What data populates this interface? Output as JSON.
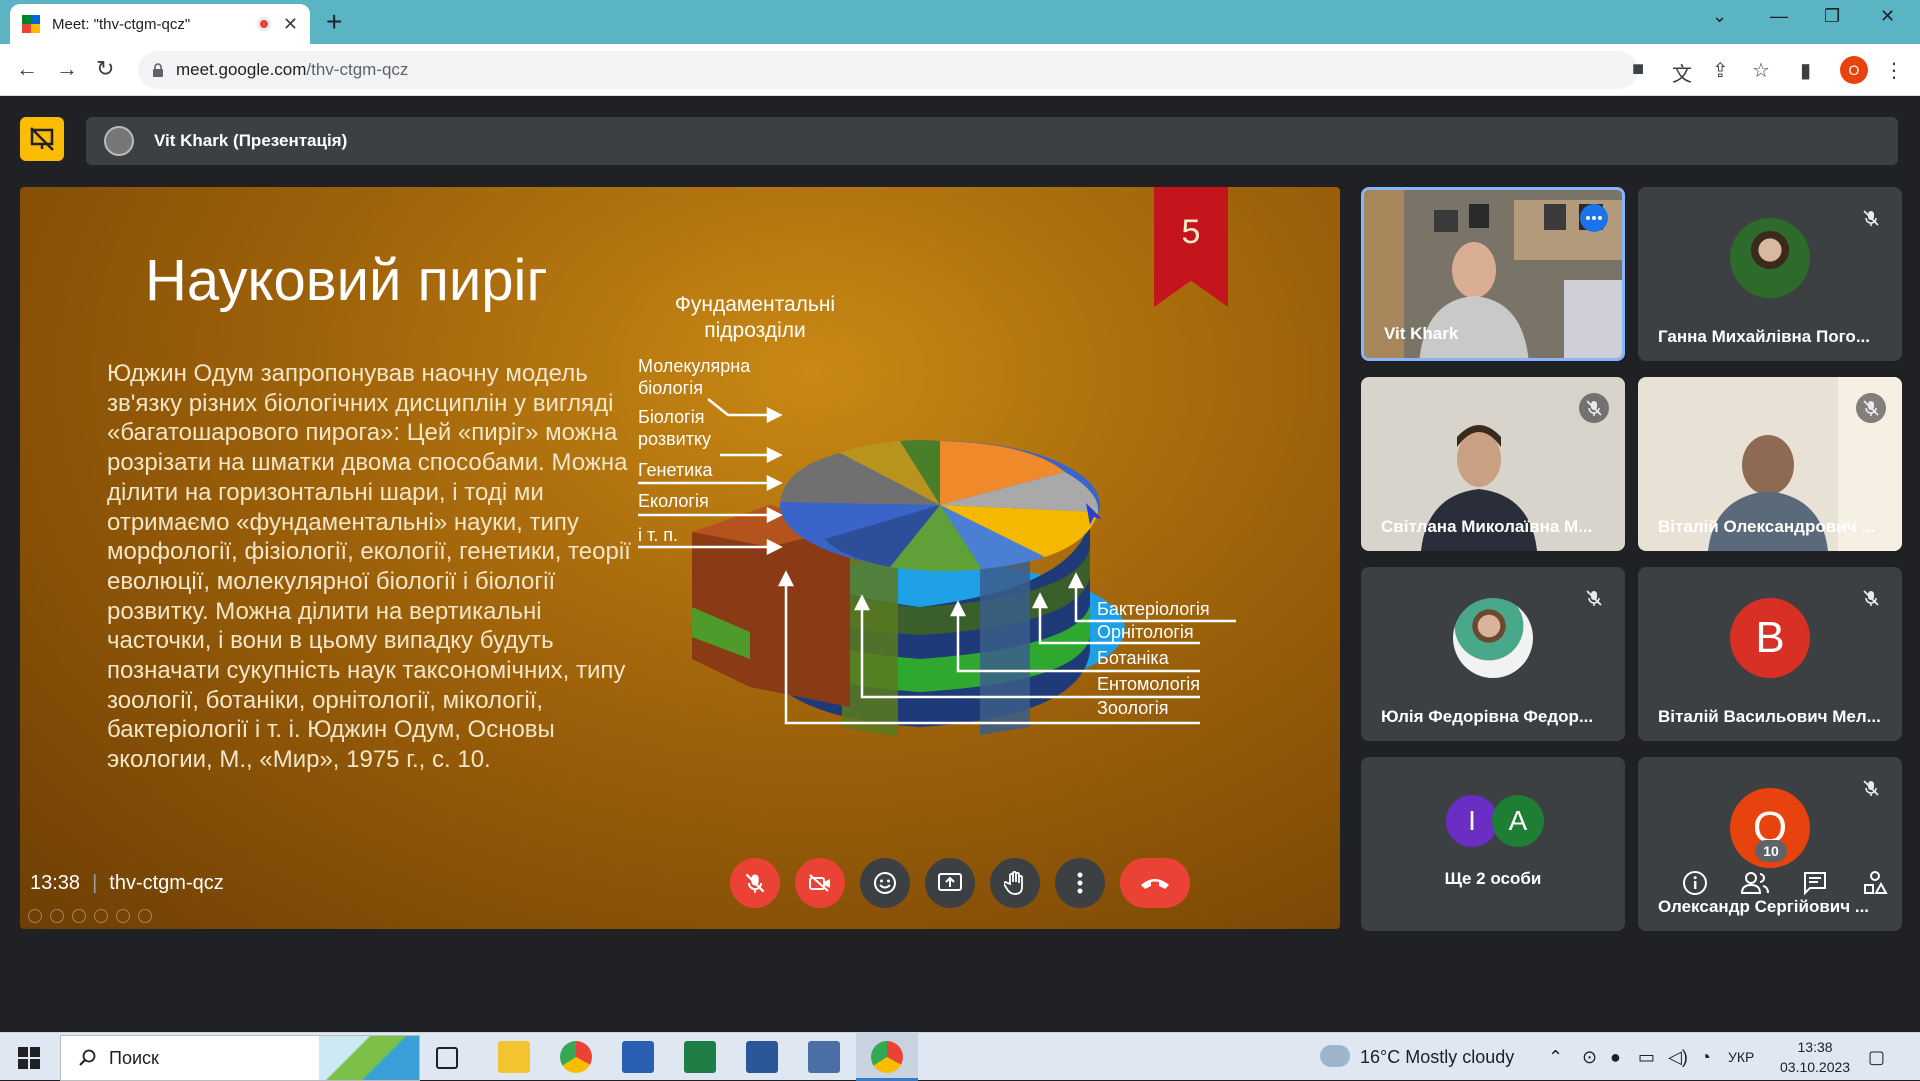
{
  "browser": {
    "tab_title": "Meet: \"thv-ctgm-qcz\"",
    "url_host": "meet.google.com",
    "url_path": "/thv-ctgm-qcz",
    "profile_letter": "O"
  },
  "meet": {
    "presenter_label": "Vit Khark (Презентація)",
    "time": "13:38",
    "meeting_code": "thv-ctgm-qcz",
    "people_count": "10"
  },
  "slide": {
    "title": "Науковий пиріг",
    "ribbon_number": "5",
    "body": "Юджин Одум запропонував наочну модель зв'язку різних біологічних дисциплін у вигляді «багатошарового пирога»: Цей «пиріг» можна розрізати на шматки двома способами. Можна ділити на горизонтальні шари, і тоді ми отримаємо «фундаментальні» науки, типу морфології, фізіології, екології, генетики, теорії еволюції, молекулярної біології і біології розвитку. Можна ділити на вертикальні часточки, і вони в цьому випадку будуть позначати сукупність наук таксономічних, типу зоології, ботаніки, орнітології, мікології, бактеріології і т. і. Юджин Одум, Основы экологии, М., «Мир», 1975 г., с. 10.",
    "diagram": {
      "heading_line1": "Фундаментальні",
      "heading_line2": "підрозділи",
      "left_labels": [
        {
          "l1": "Молекулярна",
          "l2": "біологія"
        },
        {
          "l1": "Біологія",
          "l2": "розвитку"
        },
        {
          "l1": "Генетика",
          "l2": ""
        },
        {
          "l1": "Екологія",
          "l2": ""
        },
        {
          "l1": "і т. п.",
          "l2": ""
        }
      ],
      "right_labels": [
        "Бактеріологія",
        "Орнітологія",
        "Ботаніка",
        "Ентомологія",
        "Зоологія"
      ]
    }
  },
  "participants": [
    {
      "name": "Vit Khark",
      "type": "video",
      "muted": false
    },
    {
      "name": "Ганна Михайлівна Пого...",
      "type": "photo",
      "muted": true
    },
    {
      "name": "Світлана Миколаївна М...",
      "type": "video",
      "muted": true
    },
    {
      "name": "Віталій Олександрович ...",
      "type": "video",
      "muted": true
    },
    {
      "name": "Юлія Федорівна Федор...",
      "type": "photo",
      "muted": true
    },
    {
      "name": "Віталій Васильович Мел...",
      "type": "letter",
      "letter": "В",
      "color": "#d93025",
      "muted": true
    },
    {
      "name": "Ще 2 особи",
      "type": "group",
      "letters": [
        "І",
        "А"
      ]
    },
    {
      "name": "Олександр Сергійович ...",
      "type": "letter",
      "letter": "О",
      "color": "#e8430e",
      "muted": true
    }
  ],
  "taskbar": {
    "search_text": "Поиск",
    "weather": "16°C  Mostly cloudy",
    "lang": "УКР",
    "time": "13:38",
    "date": "03.10.2023"
  },
  "colors": {
    "accent_red": "#ea4335",
    "meet_bg": "#202124",
    "tile_bg": "#3c4043",
    "present_yellow": "#fbbc04"
  }
}
